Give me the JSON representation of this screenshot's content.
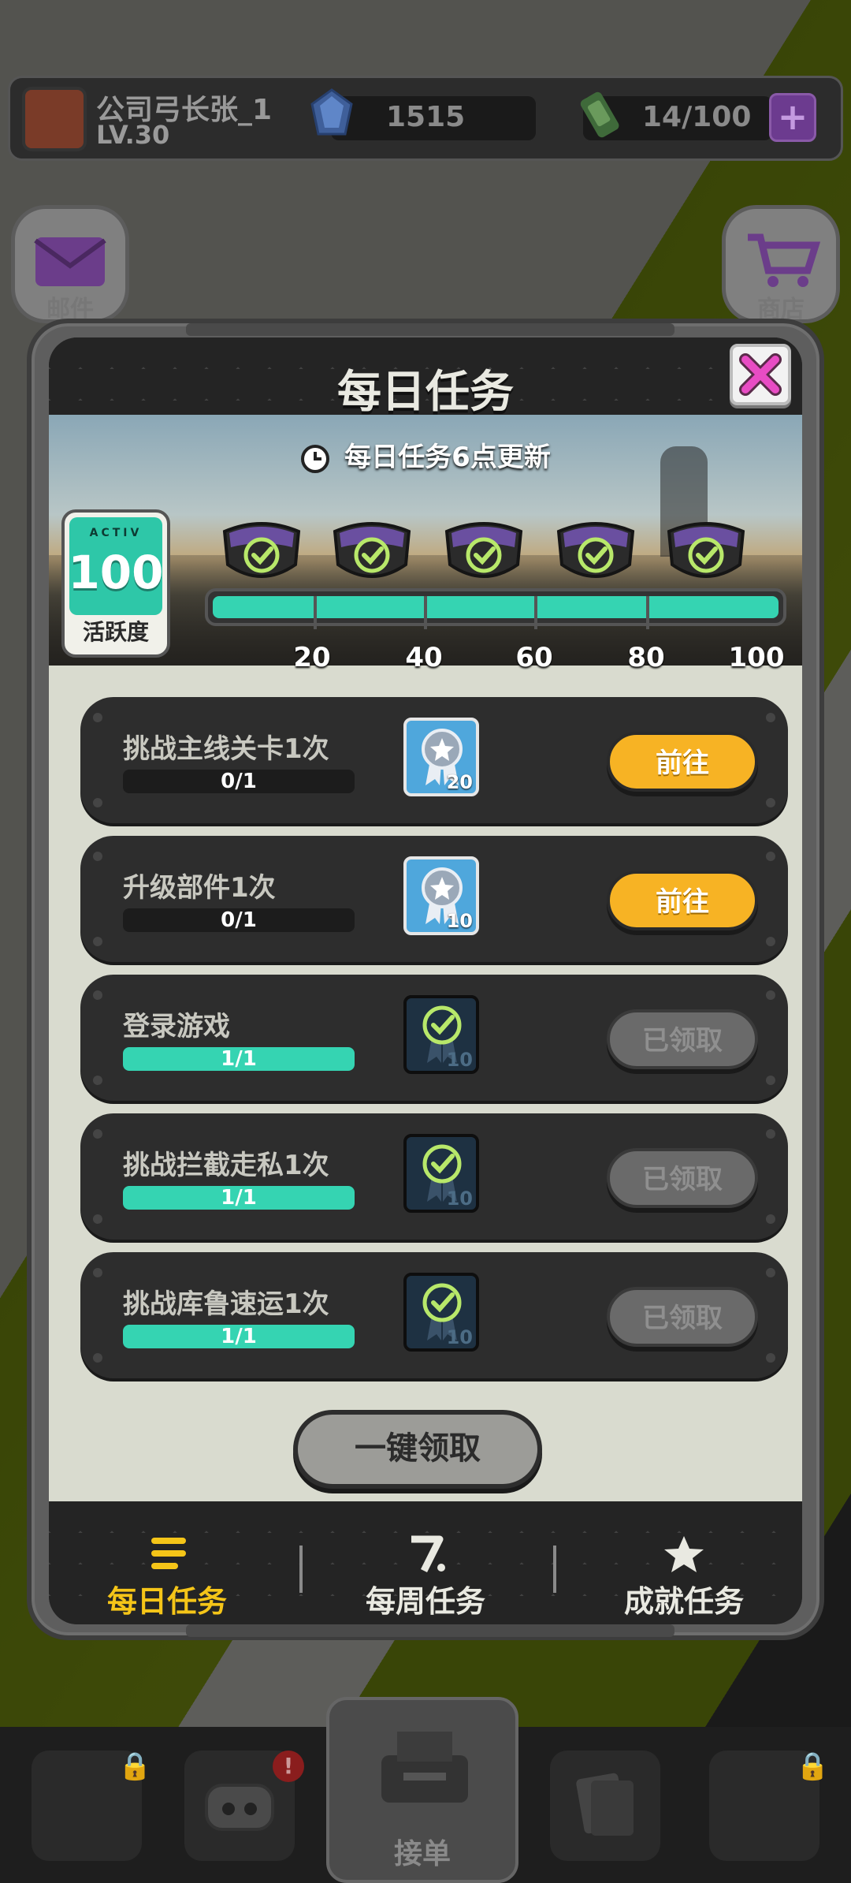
{
  "player": {
    "name": "公司弓长张_1",
    "level": "LV.30"
  },
  "currency": {
    "gems": "1515",
    "energy": "14/100",
    "plus_label": "+"
  },
  "side_buttons": {
    "mail": "邮件",
    "shop": "商店"
  },
  "bottom_nav": {
    "center_label": "接单",
    "badge": "!"
  },
  "modal": {
    "title": "每日任务",
    "refresh_text": "每日任务6点更新",
    "activity": {
      "caption": "ACTIV",
      "value": "100",
      "label": "活跃度"
    },
    "progress": {
      "value": 100,
      "max": 100,
      "milestones": [
        "20",
        "40",
        "60",
        "80",
        "100"
      ]
    },
    "tasks": [
      {
        "name": "挑战主线关卡1次",
        "progress": "0/1",
        "fill": 0,
        "reward": "20",
        "reward_style": "blue",
        "button": "前往",
        "button_style": "go"
      },
      {
        "name": "升级部件1次",
        "progress": "0/1",
        "fill": 0,
        "reward": "10",
        "reward_style": "blue",
        "button": "前往",
        "button_style": "go"
      },
      {
        "name": "登录游戏",
        "progress": "1/1",
        "fill": 1,
        "reward": "10",
        "reward_style": "dark",
        "button": "已领取",
        "button_style": "done"
      },
      {
        "name": "挑战拦截走私1次",
        "progress": "1/1",
        "fill": 1,
        "reward": "10",
        "reward_style": "dark",
        "button": "已领取",
        "button_style": "done"
      },
      {
        "name": "挑战库鲁速运1次",
        "progress": "1/1",
        "fill": 1,
        "reward": "10",
        "reward_style": "dark",
        "button": "已领取",
        "button_style": "done"
      }
    ],
    "claim_all": "一键领取",
    "tabs": [
      {
        "label": "每日任务",
        "icon": "list-icon",
        "active": true
      },
      {
        "label": "每周任务",
        "icon": "seven-icon",
        "active": false
      },
      {
        "label": "成就任务",
        "icon": "star-icon",
        "active": false
      }
    ]
  },
  "colors": {
    "accent_teal": "#35d4b2",
    "button_orange": "#f7b324",
    "tab_active": "#f5c518"
  }
}
